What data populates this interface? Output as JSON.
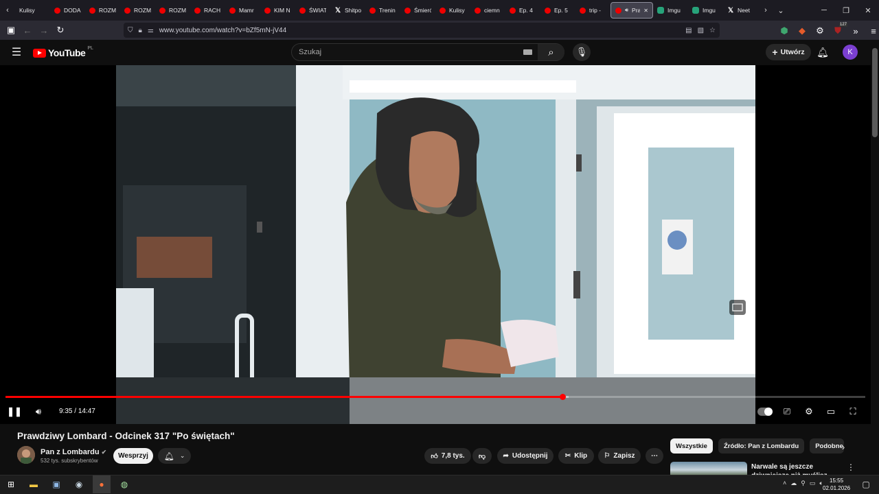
{
  "browser": {
    "tabs": [
      {
        "label": "Kulisy",
        "favicon": "none"
      },
      {
        "label": "DODA",
        "favicon": "youtube"
      },
      {
        "label": "ROZM",
        "favicon": "youtube"
      },
      {
        "label": "ROZM",
        "favicon": "youtube"
      },
      {
        "label": "ROZM",
        "favicon": "youtube"
      },
      {
        "label": "RACH",
        "favicon": "youtube"
      },
      {
        "label": "Mamr",
        "favicon": "youtube"
      },
      {
        "label": "KIM N",
        "favicon": "youtube"
      },
      {
        "label": "ŚWIAT",
        "favicon": "youtube"
      },
      {
        "label": "Shitpo",
        "favicon": "x"
      },
      {
        "label": "Trenin",
        "favicon": "youtube"
      },
      {
        "label": "Śmierć",
        "favicon": "youtube"
      },
      {
        "label": "Kulisy",
        "favicon": "youtube"
      },
      {
        "label": "ciemn",
        "favicon": "youtube"
      },
      {
        "label": "Ep. 4",
        "favicon": "youtube"
      },
      {
        "label": "Ep. 5",
        "favicon": "youtube"
      },
      {
        "label": "trip -",
        "favicon": "youtube"
      },
      {
        "label": "Pra",
        "favicon": "youtube",
        "active": true
      },
      {
        "label": "Imgu",
        "favicon": "imgur"
      },
      {
        "label": "Imgu",
        "favicon": "imgur"
      },
      {
        "label": "Neet",
        "favicon": "x"
      }
    ],
    "url": "www.youtube.com/watch?v=bZf5mN-jV44",
    "extensions_badge": "127"
  },
  "youtube": {
    "logo_text": "YouTube",
    "country_code": "PL",
    "search_placeholder": "Szukaj",
    "create_label": "Utwórz",
    "avatar_letter": "K"
  },
  "player": {
    "current_time": "9:35",
    "duration": "14:47",
    "time_separator": "/",
    "progress_fraction": 0.648,
    "buffer_fraction": 0.655
  },
  "video": {
    "title": "Prawdziwy Lombard - Odcinek 317 \"Po świętach\"",
    "channel_name": "Pan z Lombardu",
    "subscribers": "532 tys. subskrybentów",
    "support_label": "Wesprzyj",
    "likes": "7,8 tys.",
    "share_label": "Udostępnij",
    "clip_label": "Klip",
    "save_label": "Zapisz"
  },
  "sidebar": {
    "chips": [
      "Wszystkie",
      "Źródło: Pan z Lombardu",
      "Podobne"
    ],
    "suggestion_title": "Narwale są jeszcze dziwniejsze niż myślisz"
  },
  "taskbar": {
    "time": "15:55",
    "date": "02.01.2026"
  },
  "colors": {
    "accent": "#ff0000",
    "background": "#0f0f0f",
    "avatar": "#7b3fd1"
  }
}
